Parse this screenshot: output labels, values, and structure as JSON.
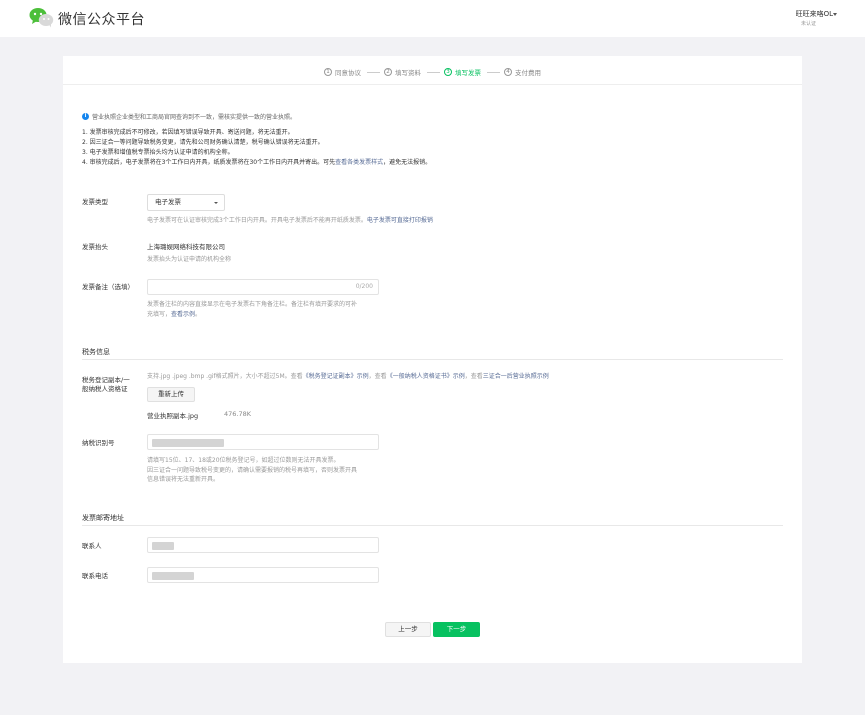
{
  "header": {
    "brand": "微信公众平台",
    "account_name": "旺旺来咯OL",
    "account_status": "未认证"
  },
  "steps": [
    {
      "num": "1",
      "label": "同意协议",
      "active": false
    },
    {
      "num": "2",
      "label": "填写资料",
      "active": false
    },
    {
      "num": "3",
      "label": "填写发票",
      "active": true
    },
    {
      "num": "4",
      "label": "支付费用",
      "active": false
    }
  ],
  "notice": "营业执照企业类型和工商局官网查询到不一致，需核实提供一致的营业执照。",
  "rules": {
    "r1": "1. 发票审核完成后不可修改，若因填写错误导致开具、寄送问题，将无法重开。",
    "r2": "2. 因三证合一等问题导致税务变更，请先和公司财务确认清楚，税号确认错误将无法重开。",
    "r3": "3. 电子发票和增值税专票抬头均为认证申请的机构全称。",
    "r4_prefix": "4. 审核完成后，电子发票将在3个工作日内开具，纸质发票将在30个工作日内开具并寄出。可先",
    "r4_link": "查看各类发票样式",
    "r4_suffix": "，避免无法报销。"
  },
  "form": {
    "invoice_type": {
      "label": "发票类型",
      "value": "电子发票",
      "hint": "电子发票可在认证审核完成3个工作日内开具。开具电子发票后不能再开纸质发票。",
      "hint_link": "电子发票可直接打印报销"
    },
    "invoice_title": {
      "label": "发票抬头",
      "value": "上海璐娱网络科技有限公司",
      "hint": "发票抬头为认证申请的机构全称"
    },
    "invoice_note": {
      "label": "发票备注（选填）",
      "counter": "0/200",
      "hint_line1": "发票备注栏的内容直接显示在电子发票右下角备注栏。备注栏有填开要求的可补",
      "hint_line2_prefix": "充填写，",
      "hint_link": "查看示例",
      "hint_suffix": "。"
    }
  },
  "tax": {
    "section_title": "税务信息",
    "cert_label_line1": "税务登记副本/一",
    "cert_label_line2": "般纳税人资格证",
    "cert_hint_prefix": "支持.jpg .jpeg .bmp .gif格式照片，大小不超过5M。查看",
    "cert_link1": "《税务登记证副本》示例",
    "cert_hint_mid": "，查看",
    "cert_link2": "《一般纳税人资格证书》示例",
    "cert_hint_mid2": "，查看",
    "cert_link3": "三证合一后营业执照示例",
    "reupload": "重新上传",
    "file_name": "营业执照副本.jpg",
    "file_size": "476.78K",
    "tax_id_label": "纳税识别号",
    "tax_hint_line1": "请填写15位、17、18或20位税务登记号，如超过位数则无法开具发票。",
    "tax_hint_line2": "因三证合一问题导致税号变更的，请确认需要报销的税号再填写，否则发票开具",
    "tax_hint_line3": "信息错误将无法重新开具。"
  },
  "address": {
    "section_title": "发票邮寄地址",
    "contact_label": "联系人",
    "phone_label": "联系电话"
  },
  "buttons": {
    "prev": "上一步",
    "next": "下一步"
  },
  "colors": {
    "primary_green": "#07c160",
    "link_blue": "#576b95",
    "info_blue": "#1485ee"
  }
}
